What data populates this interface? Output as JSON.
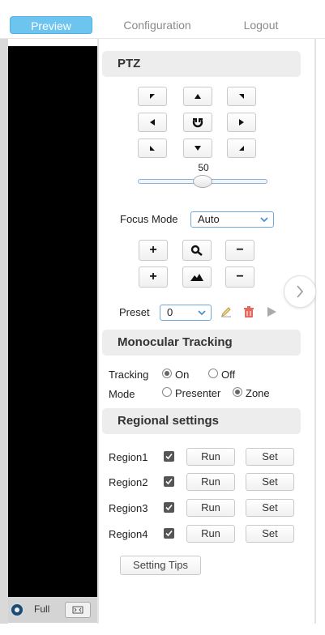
{
  "nav": {
    "preview": "Preview",
    "configuration": "Configuration",
    "logout": "Logout"
  },
  "video_bar": {
    "fullscreen_label": "Full"
  },
  "ptz": {
    "title": "PTZ",
    "speed": {
      "value": "50",
      "level": 0.5
    },
    "focus_mode_label": "Focus Mode",
    "focus_mode_value": "Auto",
    "preset_label": "Preset",
    "preset_value": "0"
  },
  "monocular": {
    "title": "Monocular Tracking",
    "tracking_label": "Tracking",
    "tracking_on": "On",
    "tracking_off": "Off",
    "tracking_selected": "On",
    "mode_label": "Mode",
    "mode_presenter": "Presenter",
    "mode_zone": "Zone",
    "mode_selected": "Zone"
  },
  "regional": {
    "title": "Regional settings",
    "regions": [
      {
        "name": "Region1",
        "checked": true,
        "run": "Run",
        "set": "Set"
      },
      {
        "name": "Region2",
        "checked": true,
        "run": "Run",
        "set": "Set"
      },
      {
        "name": "Region3",
        "checked": true,
        "run": "Run",
        "set": "Set"
      },
      {
        "name": "Region4",
        "checked": true,
        "run": "Run",
        "set": "Set"
      }
    ],
    "tips_button": "Setting Tips"
  },
  "colors": {
    "accent": "#6cc4ef",
    "section_bg": "#ededed",
    "video_bg": "#000000",
    "delete_icon": "#e06a5e"
  }
}
